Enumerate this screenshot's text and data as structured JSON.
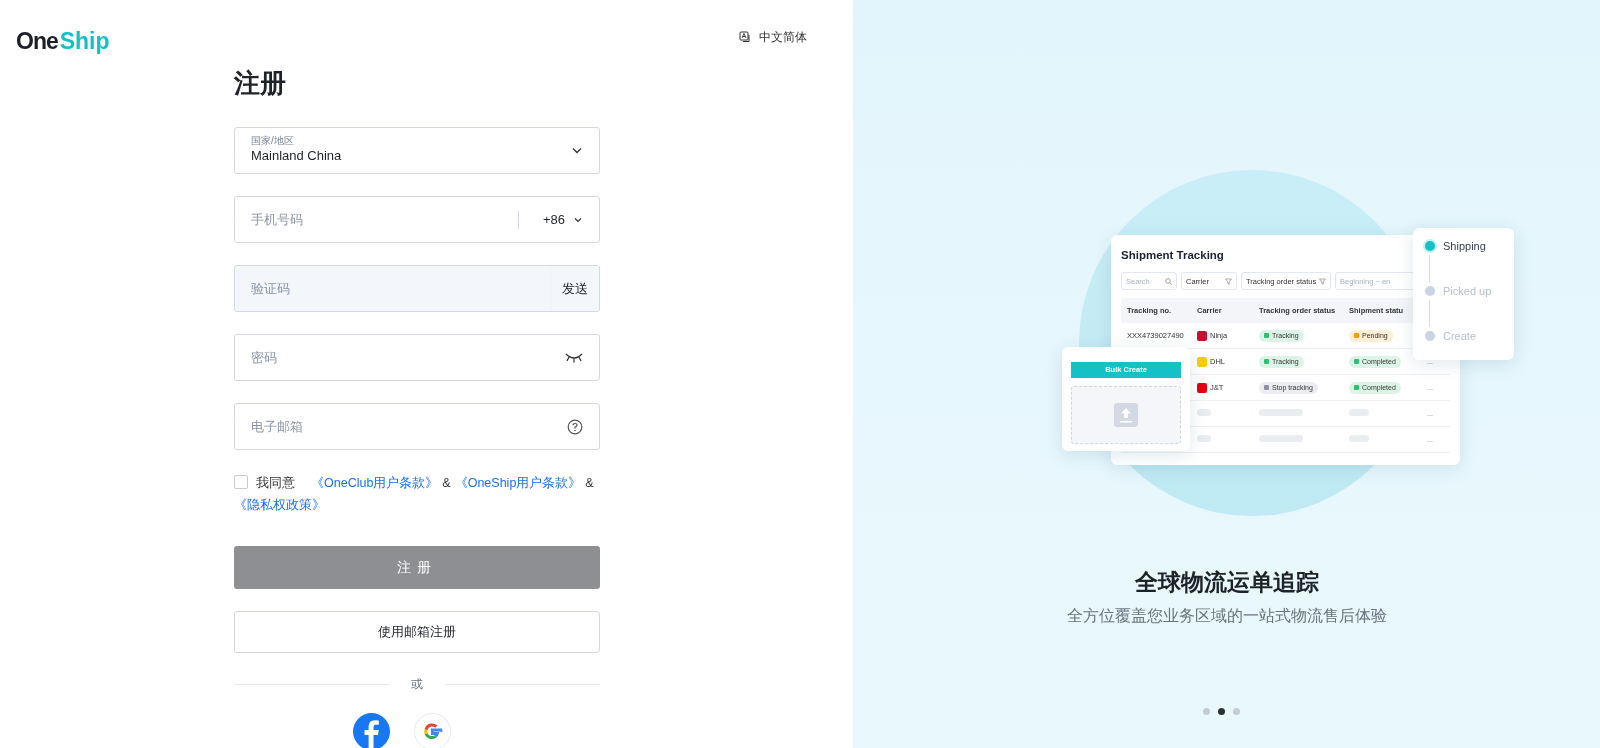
{
  "logo": {
    "first": "One",
    "second": "Ship"
  },
  "language": {
    "label": "中文简体"
  },
  "form": {
    "title": "注册",
    "country": {
      "label": "国家/地区",
      "value": "Mainland China"
    },
    "phone": {
      "placeholder": "手机号码",
      "code": "+86"
    },
    "verification": {
      "placeholder": "验证码",
      "send": "发送",
      "disabled": true
    },
    "password": {
      "placeholder": "密码"
    },
    "email": {
      "placeholder": "电子邮箱"
    },
    "agreement": {
      "checked": false,
      "prefix": "我同意",
      "parts": [
        {
          "kind": "link",
          "text": "《OneClub用户条款》"
        },
        {
          "kind": "text",
          "text": "&"
        },
        {
          "kind": "link",
          "text": "《OneShip用户条款》"
        },
        {
          "kind": "text",
          "text": "&"
        },
        {
          "kind": "link",
          "text": "《隐私权政策》"
        }
      ]
    },
    "submit": {
      "label": "注册",
      "disabled": true
    },
    "email_signup": {
      "label": "使用邮箱注册"
    },
    "divider": "或",
    "social": [
      {
        "kind": "facebook"
      },
      {
        "kind": "google"
      }
    ]
  },
  "showcase": {
    "tracking_card": {
      "title": "Shipment Tracking",
      "filters": [
        {
          "kind": "search",
          "placeholder": "Search"
        },
        {
          "kind": "filter",
          "label": "Carrier"
        },
        {
          "kind": "filter",
          "label": "Tracking order status"
        },
        {
          "kind": "date",
          "placeholder": "Beginning ~ en"
        }
      ],
      "columns": [
        "Tracking no.",
        "Carrier",
        "Tracking order status",
        "Shipment statu"
      ],
      "rows": [
        {
          "kind": "data",
          "tracking_no": "XXX4739027490",
          "carrier": {
            "name": "Ninja",
            "color": "#c8102e"
          },
          "tracking_status": {
            "label": "Tracking",
            "color": "#2fbf71"
          },
          "shipment_status": {
            "label": "Pending",
            "color": "#f59e0b"
          }
        },
        {
          "kind": "data",
          "carrier": {
            "name": "DHL",
            "color": "#ffcc00"
          },
          "tracking_status": {
            "label": "Tracking",
            "color": "#2fbf71"
          },
          "shipment_status": {
            "label": "Completed",
            "color": "#2fbf71"
          },
          "menu": "..."
        },
        {
          "kind": "data",
          "carrier": {
            "name": "J&T",
            "color": "#e60012"
          },
          "tracking_status": {
            "label": "Stop tracking",
            "color": "#8a94a6"
          },
          "shipment_status": {
            "label": "Completed",
            "color": "#2fbf71"
          },
          "menu": "..."
        },
        {
          "kind": "skeleton",
          "menu": "..."
        },
        {
          "kind": "skeleton",
          "menu": "..."
        }
      ]
    },
    "bulk_card": {
      "button": "Bulk Create"
    },
    "timeline": [
      {
        "label": "Shipping",
        "selected": true
      },
      {
        "label": "Picked up",
        "selected": false
      },
      {
        "label": "Create",
        "selected": false
      }
    ],
    "title": "全球物流运单追踪",
    "subtitle": "全方位覆盖您业务区域的一站式物流售后体验",
    "dots": [
      {
        "selected": false
      },
      {
        "selected": true
      },
      {
        "selected": false
      }
    ]
  }
}
